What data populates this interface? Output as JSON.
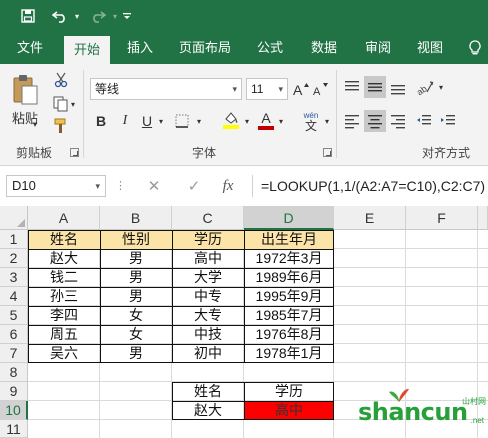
{
  "quick_access": {
    "save_icon": "save-icon",
    "undo_icon": "undo-icon",
    "redo_icon": "redo-icon",
    "customize_icon": "customize-qat-icon"
  },
  "tabs": [
    "文件",
    "开始",
    "插入",
    "页面布局",
    "公式",
    "数据",
    "审阅",
    "视图"
  ],
  "active_tab": "开始",
  "ribbon": {
    "paste_label": "粘贴",
    "clipboard_label": "剪贴板",
    "font_label": "字体",
    "align_label": "对齐方式",
    "font_name": "等线",
    "font_size": "11",
    "bold": "B",
    "italic": "I",
    "underline": "U",
    "font_color_glyph": "A",
    "phonetic_top": "wén",
    "phonetic_bottom": "文"
  },
  "formula_bar": {
    "name_box": "D10",
    "cancel_glyph": "✕",
    "enter_glyph": "✓",
    "fx_glyph": "fx",
    "formula": "=LOOKUP(1,1/(A2:A7=C10),C2:C7)"
  },
  "columns": [
    "A",
    "B",
    "C",
    "D",
    "E",
    "F"
  ],
  "rows": [
    "1",
    "2",
    "3",
    "4",
    "5",
    "6",
    "7",
    "8",
    "9",
    "10",
    "11"
  ],
  "table": {
    "header": [
      "姓名",
      "性别",
      "学历",
      "出生年月"
    ],
    "rows": [
      [
        "赵大",
        "男",
        "高中",
        "1972年3月"
      ],
      [
        "钱二",
        "男",
        "大学",
        "1989年6月"
      ],
      [
        "孙三",
        "男",
        "中专",
        "1995年9月"
      ],
      [
        "李四",
        "女",
        "大专",
        "1985年7月"
      ],
      [
        "周五",
        "女",
        "中技",
        "1976年8月"
      ],
      [
        "吴六",
        "男",
        "初中",
        "1978年1月"
      ]
    ]
  },
  "lookup": {
    "label_name": "姓名",
    "label_edu": "学历",
    "value_name": "赵大",
    "value_edu": "高中"
  },
  "colors": {
    "accent": "#217346",
    "header_fill": "#fce4a8",
    "result_fill": "#ff0000"
  },
  "watermark": {
    "text": "shancun",
    "sub": "山村网",
    "domain": ".net"
  }
}
